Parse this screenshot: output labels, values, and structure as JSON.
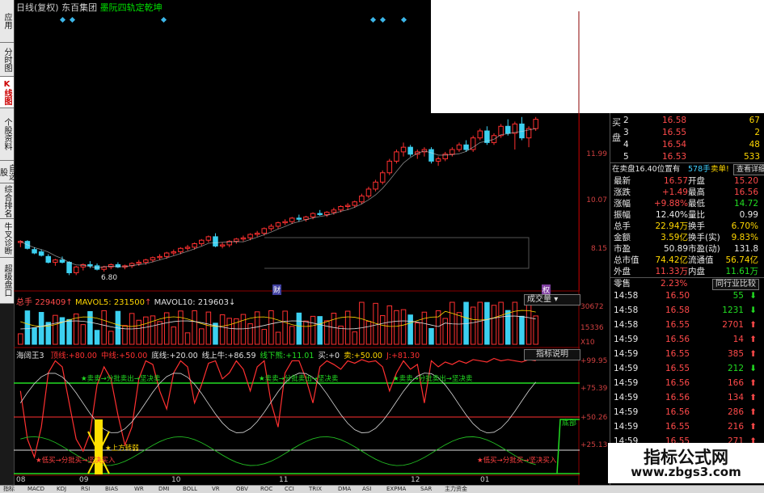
{
  "left_tabs": [
    {
      "label": "应用",
      "active": false
    },
    {
      "label": "分时图",
      "active": false
    },
    {
      "label": "K线图",
      "active": true
    },
    {
      "label": "个股资料",
      "active": false
    },
    {
      "label": "自选股",
      "active": false
    },
    {
      "label": "综合排名",
      "active": false
    },
    {
      "label": "牛叉诊断",
      "active": false
    },
    {
      "label": "超级盘口",
      "active": false
    }
  ],
  "header": {
    "period": "日线(复权)",
    "stock_name": "东百集团",
    "indicator_name": "墨阮四轨定乾坤"
  },
  "price_axis": [
    "11.99",
    "10.07",
    "8.15"
  ],
  "low_label": "6.80",
  "event_markers": [
    "财",
    "权"
  ],
  "volume_header": {
    "total_label": "总手",
    "total_value": "229409",
    "mavol5_label": "MAVOL5:",
    "mavol5_value": "231500",
    "mavol10_label": "MAVOL10:",
    "mavol10_value": "219603"
  },
  "volume_tab": "成交量",
  "volume_axis": [
    "30672",
    "15336",
    "X10"
  ],
  "indicator_header": {
    "name": "海阔王3",
    "parts": [
      {
        "text": "顶线:+80.00",
        "color": "#ff3030"
      },
      {
        "text": "中线:+50.00",
        "color": "#ff3030"
      },
      {
        "text": "底线:+20.00",
        "color": "#e0e0e0"
      },
      {
        "text": "线上牛:+86.59",
        "color": "#e0e0e0"
      },
      {
        "text": "线下熊:+11.01",
        "color": "#22dd22"
      },
      {
        "text": "买:+0",
        "color": "#e0e0e0"
      },
      {
        "text": "卖:+50.00",
        "color": "#ffd700"
      },
      {
        "text": "J:+81.30",
        "color": "#ff3030"
      }
    ]
  },
  "indicator_button": "指标说明",
  "indicator_axis": [
    "+99.95",
    "+75.39",
    "+50.26",
    "+25.13"
  ],
  "indicator_notes": {
    "sell": "★卖卖→分批卖出→坚决卖",
    "mid_bull": "★上方转弱",
    "buy": "★低买→分批买→坚决买入",
    "right_tag": "底部"
  },
  "date_axis": [
    "08",
    "09",
    "10",
    "11",
    "12",
    "01"
  ],
  "quote": {
    "buy_label": "买盘",
    "order_book": [
      {
        "level": "2",
        "price": "16.58",
        "vol": "67"
      },
      {
        "level": "3",
        "price": "16.55",
        "vol": "2"
      },
      {
        "level": "4",
        "price": "16.54",
        "vol": "48"
      },
      {
        "level": "5",
        "price": "16.53",
        "vol": "533"
      }
    ],
    "pending": {
      "text": "在卖盘16.40位置有",
      "vol": "578手",
      "alert": "卖单!",
      "detail": "查看详细"
    },
    "stats": [
      {
        "k1": "最新",
        "v1": "16.57",
        "c1": "red",
        "k2": "开盘",
        "v2": "15.20",
        "c2": "red"
      },
      {
        "k1": "涨跌",
        "v1": "+1.49",
        "c1": "red",
        "k2": "最高",
        "v2": "16.56",
        "c2": "red"
      },
      {
        "k1": "涨幅",
        "v1": "+9.88%",
        "c1": "red",
        "k2": "最低",
        "v2": "14.72",
        "c2": "grn"
      },
      {
        "k1": "振幅",
        "v1": "12.40%",
        "c1": "wht",
        "k2": "量比",
        "v2": "0.99",
        "c2": "wht"
      },
      {
        "k1": "总手",
        "v1": "22.94万",
        "c1": "yel",
        "k2": "换手",
        "v2": "6.70%",
        "c2": "yel"
      },
      {
        "k1": "金额",
        "v1": "3.59亿",
        "c1": "yel",
        "k2": "换手(实)",
        "v2": "9.83%",
        "c2": "yel"
      },
      {
        "k1": "市盈",
        "v1": "50.89",
        "c1": "wht",
        "k2": "市盈(动)",
        "v2": "131.8",
        "c2": "wht"
      },
      {
        "k1": "总市值",
        "v1": "74.42亿",
        "c1": "yel",
        "k2": "流通值",
        "v2": "56.74亿",
        "c2": "yel"
      },
      {
        "k1": "外盘",
        "v1": "11.33万",
        "c1": "red",
        "k2": "内盘",
        "v2": "11.61万",
        "c2": "grn"
      }
    ],
    "sector": {
      "name": "零售",
      "change": "2.23%",
      "compare_button": "同行业比较"
    },
    "ticks": [
      {
        "time": "14:58",
        "price": "16.50",
        "vol": "55",
        "dir": "down"
      },
      {
        "time": "14:58",
        "price": "16.58",
        "vol": "1231",
        "dir": "down"
      },
      {
        "time": "14:58",
        "price": "16.55",
        "vol": "2701",
        "dir": "up"
      },
      {
        "time": "14:59",
        "price": "16.56",
        "vol": "14",
        "dir": "up"
      },
      {
        "time": "14:59",
        "price": "16.55",
        "vol": "385",
        "dir": "up"
      },
      {
        "time": "14:59",
        "price": "16.55",
        "vol": "212",
        "dir": "down"
      },
      {
        "time": "14:59",
        "price": "16.56",
        "vol": "166",
        "dir": "up"
      },
      {
        "time": "14:59",
        "price": "16.56",
        "vol": "134",
        "dir": "up"
      },
      {
        "time": "14:59",
        "price": "16.56",
        "vol": "286",
        "dir": "up"
      },
      {
        "time": "14:59",
        "price": "16.55",
        "vol": "216",
        "dir": "up"
      },
      {
        "time": "14:59",
        "price": "16.55",
        "vol": "271",
        "dir": "up"
      },
      {
        "time": "14:59",
        "price": "16.55",
        "vol": "871",
        "dir": "up"
      }
    ]
  },
  "watermark": {
    "line1": "指标公式网",
    "line2": "www.zbgs3.com"
  },
  "bottom_tabs": [
    "指标",
    "MACD",
    "KDJ",
    "RSI",
    "BIAS",
    "WR",
    "DMI",
    "BOLL",
    "VR",
    "OBV",
    "ROC",
    "CCI",
    "TRIX",
    "DMA",
    "ASI",
    "EXPMA",
    "SAR",
    "主力资金"
  ],
  "colors": {
    "up": "#ff3030",
    "down": "#3cd0f0",
    "green_line": "#22dd22",
    "axis": "#8b0000"
  },
  "chart_data": {
    "type": "candlestick",
    "candles": [
      [
        8.2,
        8.3,
        8.0,
        8.25
      ],
      [
        8.25,
        8.3,
        7.9,
        7.95
      ],
      [
        7.9,
        8.0,
        7.7,
        7.75
      ],
      [
        7.8,
        7.9,
        7.6,
        7.65
      ],
      [
        7.6,
        7.7,
        7.3,
        7.35
      ],
      [
        7.35,
        7.5,
        7.2,
        7.45
      ],
      [
        7.45,
        7.6,
        7.3,
        7.35
      ],
      [
        7.35,
        7.4,
        6.8,
        6.9
      ],
      [
        6.9,
        7.2,
        6.8,
        7.15
      ],
      [
        7.15,
        7.3,
        7.0,
        7.25
      ],
      [
        7.25,
        7.4,
        7.1,
        7.2
      ],
      [
        7.2,
        7.3,
        7.0,
        7.05
      ],
      [
        7.05,
        7.2,
        6.95,
        7.15
      ],
      [
        7.15,
        7.3,
        7.05,
        7.25
      ],
      [
        7.25,
        7.35,
        7.1,
        7.15
      ],
      [
        7.15,
        7.25,
        7.05,
        7.2
      ],
      [
        7.2,
        7.35,
        7.1,
        7.3
      ],
      [
        7.3,
        7.45,
        7.2,
        7.35
      ],
      [
        7.35,
        7.5,
        7.25,
        7.45
      ],
      [
        7.45,
        7.6,
        7.35,
        7.55
      ],
      [
        7.55,
        7.7,
        7.45,
        7.6
      ],
      [
        7.6,
        7.8,
        7.5,
        7.75
      ],
      [
        7.75,
        7.9,
        7.65,
        7.8
      ],
      [
        7.8,
        8.0,
        7.7,
        7.95
      ],
      [
        7.95,
        8.1,
        7.85,
        8.0
      ],
      [
        8.0,
        8.2,
        7.9,
        8.15
      ],
      [
        8.15,
        8.35,
        8.05,
        8.3
      ],
      [
        8.3,
        8.5,
        8.2,
        8.45
      ],
      [
        8.45,
        8.6,
        8.0,
        8.05
      ],
      [
        8.05,
        8.2,
        7.95,
        8.1
      ],
      [
        8.1,
        8.3,
        8.0,
        8.25
      ],
      [
        8.25,
        8.4,
        8.15,
        8.35
      ],
      [
        8.35,
        8.5,
        8.25,
        8.4
      ],
      [
        8.4,
        8.6,
        8.3,
        8.55
      ],
      [
        8.55,
        8.7,
        8.45,
        8.6
      ],
      [
        8.6,
        8.85,
        8.5,
        8.8
      ],
      [
        8.8,
        9.0,
        8.7,
        8.9
      ],
      [
        8.9,
        9.1,
        8.8,
        9.05
      ],
      [
        9.05,
        9.2,
        8.95,
        9.1
      ],
      [
        9.1,
        9.3,
        9.0,
        9.25
      ],
      [
        9.25,
        9.4,
        9.1,
        9.2
      ],
      [
        9.2,
        9.35,
        9.1,
        9.3
      ],
      [
        9.3,
        9.5,
        9.2,
        9.45
      ],
      [
        9.45,
        9.6,
        9.35,
        9.4
      ],
      [
        9.4,
        9.55,
        9.3,
        9.5
      ],
      [
        9.5,
        9.7,
        9.4,
        9.6
      ],
      [
        9.6,
        9.8,
        9.5,
        9.75
      ],
      [
        9.75,
        9.9,
        9.6,
        9.8
      ],
      [
        9.8,
        10.0,
        9.7,
        9.95
      ],
      [
        9.95,
        10.3,
        9.85,
        10.2
      ],
      [
        10.2,
        10.6,
        10.1,
        10.5
      ],
      [
        10.5,
        10.9,
        10.4,
        10.8
      ],
      [
        10.8,
        11.3,
        10.7,
        11.2
      ],
      [
        11.2,
        11.8,
        11.1,
        11.7
      ],
      [
        11.7,
        12.2,
        11.6,
        12.1
      ],
      [
        12.1,
        12.5,
        11.9,
        12.3
      ],
      [
        12.3,
        12.4,
        11.9,
        12.0
      ],
      [
        12.0,
        12.2,
        11.8,
        12.1
      ],
      [
        12.1,
        12.3,
        11.9,
        12.2
      ],
      [
        12.2,
        12.3,
        11.6,
        11.7
      ],
      [
        11.7,
        11.9,
        11.5,
        11.8
      ],
      [
        11.8,
        12.1,
        11.7,
        12.0
      ],
      [
        12.0,
        12.3,
        11.9,
        12.2
      ],
      [
        12.2,
        12.5,
        12.1,
        12.4
      ],
      [
        12.4,
        12.6,
        12.1,
        12.2
      ],
      [
        12.2,
        12.8,
        12.1,
        12.7
      ],
      [
        12.7,
        13.1,
        12.6,
        13.0
      ],
      [
        13.0,
        13.2,
        12.4,
        12.5
      ],
      [
        12.5,
        12.9,
        12.4,
        12.8
      ],
      [
        12.8,
        13.3,
        12.7,
        13.2
      ],
      [
        13.2,
        13.5,
        12.8,
        12.9
      ],
      [
        12.9,
        13.4,
        12.2,
        13.3
      ],
      [
        13.3,
        13.6,
        12.6,
        12.7
      ],
      [
        12.7,
        13.2,
        12.3,
        13.1
      ],
      [
        13.1,
        13.6,
        13.0,
        13.5
      ]
    ],
    "ylim": [
      6.5,
      13.8
    ]
  }
}
